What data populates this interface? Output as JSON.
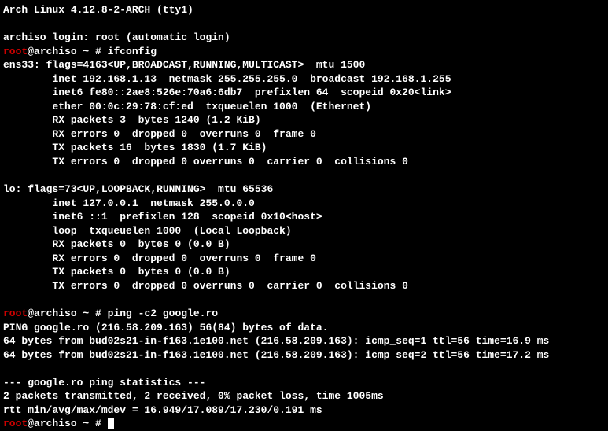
{
  "header": "Arch Linux 4.12.8-2-ARCH (tty1)",
  "login_line": "archiso login: root (automatic login)",
  "prompt": {
    "user": "root",
    "at_host_path": "@archiso ~ # "
  },
  "cmd1": "ifconfig",
  "ifconfig_out": [
    "ens33: flags=4163<UP,BROADCAST,RUNNING,MULTICAST>  mtu 1500",
    "        inet 192.168.1.13  netmask 255.255.255.0  broadcast 192.168.1.255",
    "        inet6 fe80::2ae8:526e:70a6:6db7  prefixlen 64  scopeid 0x20<link>",
    "        ether 00:0c:29:78:cf:ed  txqueuelen 1000  (Ethernet)",
    "        RX packets 3  bytes 1240 (1.2 KiB)",
    "        RX errors 0  dropped 0  overruns 0  frame 0",
    "        TX packets 16  bytes 1830 (1.7 KiB)",
    "        TX errors 0  dropped 0 overruns 0  carrier 0  collisions 0",
    "",
    "lo: flags=73<UP,LOOPBACK,RUNNING>  mtu 65536",
    "        inet 127.0.0.1  netmask 255.0.0.0",
    "        inet6 ::1  prefixlen 128  scopeid 0x10<host>",
    "        loop  txqueuelen 1000  (Local Loopback)",
    "        RX packets 0  bytes 0 (0.0 B)",
    "        RX errors 0  dropped 0  overruns 0  frame 0",
    "        TX packets 0  bytes 0 (0.0 B)",
    "        TX errors 0  dropped 0 overruns 0  carrier 0  collisions 0",
    ""
  ],
  "cmd2": "ping -c2 google.ro",
  "ping_out": [
    "PING google.ro (216.58.209.163) 56(84) bytes of data.",
    "64 bytes from bud02s21-in-f163.1e100.net (216.58.209.163): icmp_seq=1 ttl=56 time=16.9 ms",
    "64 bytes from bud02s21-in-f163.1e100.net (216.58.209.163): icmp_seq=2 ttl=56 time=17.2 ms",
    "",
    "--- google.ro ping statistics ---",
    "2 packets transmitted, 2 received, 0% packet loss, time 1005ms",
    "rtt min/avg/max/mdev = 16.949/17.089/17.230/0.191 ms"
  ]
}
